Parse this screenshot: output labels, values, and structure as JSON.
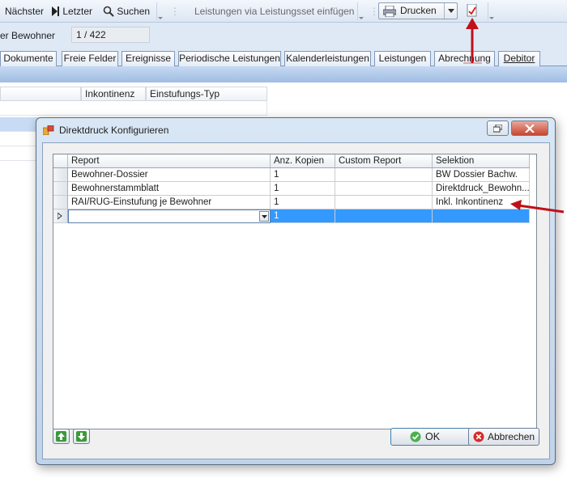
{
  "toolbar": {
    "next_label": "Nächster",
    "last_label": "Letzter",
    "search_label": "Suchen",
    "insert_label": "Leistungen via Leistungsset einfügen",
    "print_label": "Drucken"
  },
  "info": {
    "resident_label": "er Bewohner",
    "counter": "1 / 422"
  },
  "tabs": [
    "Dokumente",
    "Freie Felder",
    "Ereignisse",
    "Periodische Leistungen",
    "Kalenderleistungen",
    "Leistungen",
    "Abrechnung",
    "Debitor"
  ],
  "bg_grid": {
    "col1": "Inkontinenz",
    "col2": "Einstufungs-Typ"
  },
  "dialog": {
    "title": "Direktdruck Konfigurieren",
    "columns": [
      "Report",
      "Anz. Kopien",
      "Custom Report",
      "Selektion"
    ],
    "rows": [
      {
        "report": "Bewohner-Dossier",
        "copies": "1",
        "custom": "",
        "selection": "BW Dossier Bachw."
      },
      {
        "report": "Bewohnerstammblatt",
        "copies": "1",
        "custom": "",
        "selection": "Direktdruck_Bewohn..."
      },
      {
        "report": "RAI/RUG-Einstufung je Bewohner",
        "copies": "1",
        "custom": "",
        "selection": "Inkl. Inkontinenz"
      }
    ],
    "new_row": {
      "report": "",
      "copies": "1",
      "custom": "",
      "selection": ""
    },
    "ok_label": "OK",
    "cancel_label": "Abbrechen"
  },
  "colors": {
    "selection": "#3399ff",
    "arrow": "#c0101a",
    "dialog_frame": "#bfd3ea"
  }
}
